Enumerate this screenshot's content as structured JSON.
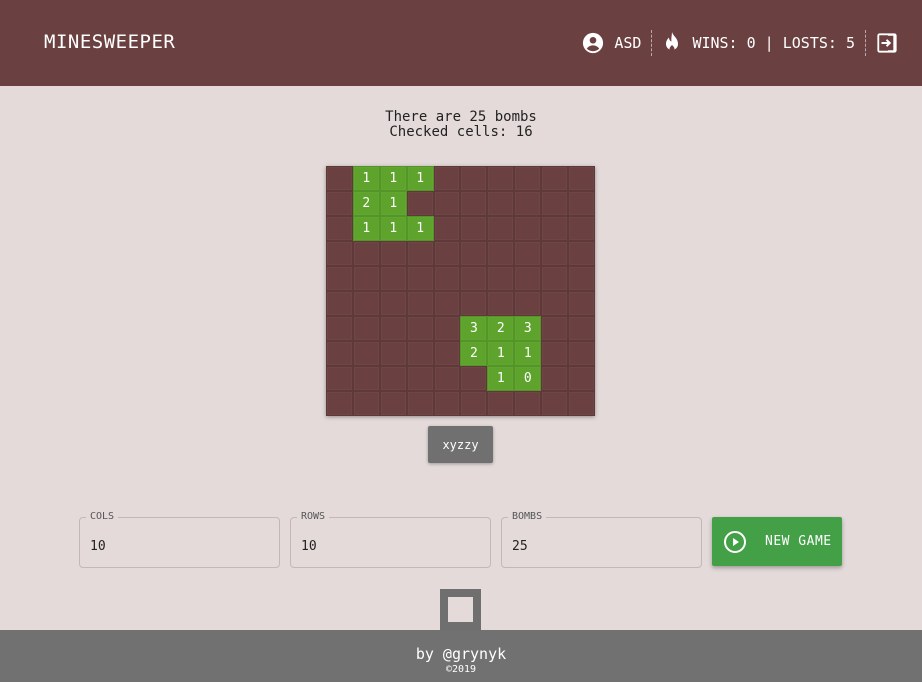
{
  "header": {
    "title": "MINESWEEPER",
    "username": "ASD",
    "stats": "WINS: 0 | LOSTS: 5"
  },
  "game": {
    "bombs_text": "There are 25 bombs",
    "checked_text": "Checked cells: 16",
    "rows": 10,
    "cols": 10,
    "cells": [
      [
        "",
        "1",
        "1",
        "1",
        "",
        "",
        "",
        "",
        "",
        ""
      ],
      [
        "",
        "2",
        "1",
        "",
        "",
        "",
        "",
        "",
        "",
        ""
      ],
      [
        "",
        "1",
        "1",
        "1",
        "",
        "",
        "",
        "",
        "",
        ""
      ],
      [
        "",
        "",
        "",
        "",
        "",
        "",
        "",
        "",
        "",
        ""
      ],
      [
        "",
        "",
        "",
        "",
        "",
        "",
        "",
        "",
        "",
        ""
      ],
      [
        "",
        "",
        "",
        "",
        "",
        "",
        "",
        "",
        "",
        ""
      ],
      [
        "",
        "",
        "",
        "",
        "",
        "3",
        "2",
        "3",
        "",
        ""
      ],
      [
        "",
        "",
        "",
        "",
        "",
        "2",
        "1",
        "1",
        "",
        ""
      ],
      [
        "",
        "",
        "",
        "",
        "",
        "",
        "1",
        "0",
        "",
        ""
      ],
      [
        "",
        "",
        "",
        "",
        "",
        "",
        "",
        "",
        "",
        ""
      ]
    ],
    "cheat_label": "xyzzy"
  },
  "settings": {
    "cols_label": "COLS",
    "cols_value": "10",
    "rows_label": "ROWS",
    "rows_value": "10",
    "bombs_label": "BOMBS",
    "bombs_value": "25",
    "new_game_label": "NEW GAME"
  },
  "footer": {
    "by": "by @grynyk",
    "copyright": "©2019"
  },
  "colors": {
    "header_bg": "#6b4041",
    "page_bg": "#e3dad9",
    "cell_closed": "#6b4041",
    "cell_open": "#5ea32c",
    "button_green": "#43a047",
    "footer_bg": "#717171"
  }
}
